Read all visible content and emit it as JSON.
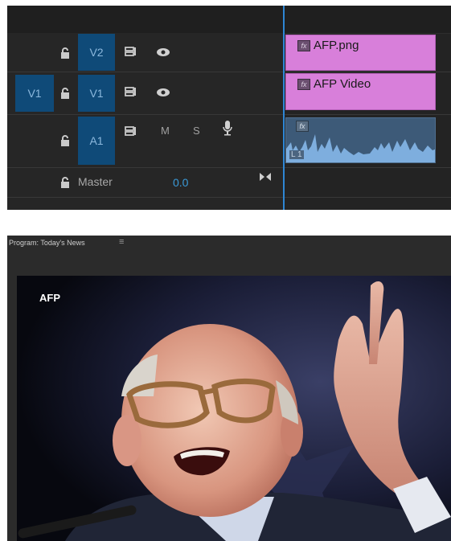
{
  "timeline": {
    "tracks": {
      "v2": {
        "target": "",
        "label": "V2"
      },
      "v1": {
        "target": "V1",
        "label": "V1"
      },
      "a1": {
        "label": "A1",
        "mute": "M",
        "solo": "S"
      },
      "master": {
        "label": "Master",
        "value": "0.0"
      }
    },
    "clips": {
      "v2_clip": "AFP.png",
      "v1_clip": "AFP Video",
      "fx": "fx",
      "audio_channel": "L 1"
    }
  },
  "program": {
    "title": "Program: Today's News",
    "menu_icon": "≡",
    "watermark": "AFP"
  },
  "icons": [
    "lock-icon",
    "sync-lock-icon",
    "eye-icon",
    "microphone-icon",
    "keyframe-icon",
    "hamburger-menu-icon"
  ],
  "colors": {
    "track_target": "#0f4a78",
    "clip_video": "#d87fda",
    "clip_audio": "#3d5a78",
    "playhead": "#2e86d4",
    "value": "#3a9bd9"
  }
}
